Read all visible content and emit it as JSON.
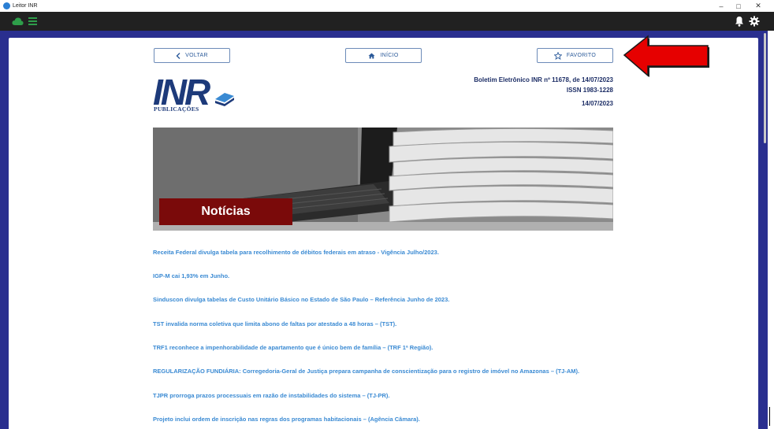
{
  "window": {
    "title": "Leitor INR",
    "minimize": "–",
    "maximize": "□",
    "close": "✕"
  },
  "toolbar": {
    "left_icons": [
      "cloud-icon",
      "menu-icon"
    ],
    "right_icons": [
      "bell-icon",
      "gear-icon"
    ],
    "accent": "#2e9e4a"
  },
  "nav": {
    "back_label": "VOLTAR",
    "home_label": "INÍCIO",
    "favorite_label": "FAVORITO"
  },
  "logo": {
    "main": "INR",
    "sub": "PUBLICAÇÕES"
  },
  "bulletin": {
    "title": "Boletim Eletrônico INR nº 11678, de 14/07/2023",
    "issn": "ISSN 1983-1228",
    "date": "14/07/2023"
  },
  "banner": {
    "label": "Notícias"
  },
  "news": [
    "Receita Federal divulga tabela para recolhimento de débitos federais em atraso - Vigência Julho/2023.",
    "IGP-M cai 1,93% em Junho.",
    "Sinduscon divulga tabelas de Custo Unitário Básico no Estado de São Paulo – Referência Junho de 2023.",
    "TST invalida norma coletiva que limita abono de faltas por atestado a 48 horas – (TST).",
    "TRF1 reconhece a impenhorabilidade de apartamento que é único bem de família – (TRF 1ª Região).",
    "REGULARIZAÇÃO FUNDIÁRIA: Corregedoria-Geral de Justiça prepara campanha de conscientização para o registro de imóvel no Amazonas – (TJ-AM).",
    "TJPR prorroga prazos processuais em razão de instabilidades do sistema – (TJ-PR).",
    "Projeto inclui ordem de inscrição nas regras dos programas habitacionais – (Agência Câmara)."
  ],
  "colors": {
    "frame": "#2a2f8f",
    "link": "#3a8ad3",
    "arrow": "#e60000",
    "banner_label": "#7a0a0a"
  }
}
